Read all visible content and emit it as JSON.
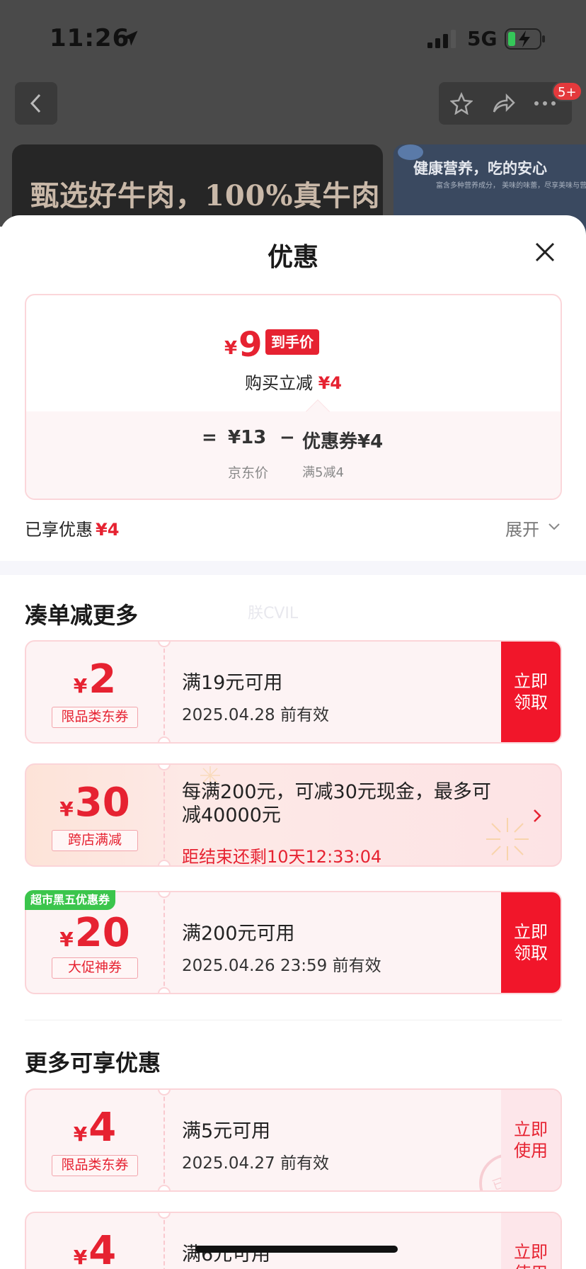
{
  "status_bar": {
    "time": "11:26",
    "network": "5G",
    "icons": [
      "location-icon",
      "signal-icon",
      "battery-charging-icon"
    ]
  },
  "background": {
    "cart_badge": "5+",
    "banner_main": "甄选好牛肉，100%真牛肉",
    "banner_side": "健康营养，吃的安心",
    "banner_side_sub": "富含多种营养成分，\n美味的味蕾，尽享美味与营养的双重盛宴。"
  },
  "sheet": {
    "title": "优惠",
    "price_card": {
      "currency": "¥",
      "final_price": "9",
      "final_tag": "到手价",
      "instant_label": "购买立减",
      "instant_amount": "¥4",
      "eq": "=",
      "jd_price": "¥13",
      "minus": "−",
      "coupon_part": "优惠券¥4",
      "jd_label": "京东价",
      "coupon_rule": "满5减4"
    },
    "enjoyed_label": "已享优惠",
    "enjoyed_amount": "¥4",
    "expand_label": "展开",
    "watermark": "朕CVIL",
    "section1_title": "凑单减更多",
    "section2_title": "更多可享优惠"
  },
  "coupons": [
    {
      "currency": "¥",
      "amount": "2",
      "type": "限品类东券",
      "condition": "满19元可用",
      "validity": "2025.04.28 前有效",
      "action": "立即领取"
    },
    {
      "currency": "¥",
      "amount": "30",
      "type": "跨店满减",
      "description": "每满200元，可减30元现金，最多可减40000元",
      "countdown": "距结束还剩10天12:33:04"
    },
    {
      "currency": "¥",
      "amount": "20",
      "type": "大促神券",
      "tag": "超市黑五优惠券",
      "condition": "满200元可用",
      "validity": "2025.04.26 23:59 前有效",
      "action": "立即领取"
    },
    {
      "currency": "¥",
      "amount": "4",
      "type": "限品类东券",
      "condition": "满5元可用",
      "validity": "2025.04.27 前有效",
      "action": "立即使用",
      "stamp": "已领"
    },
    {
      "currency": "¥",
      "amount": "4",
      "condition": "满6元可用",
      "action": "立即使用"
    }
  ],
  "colors": {
    "accent": "#e62231",
    "button_red": "#f1162a",
    "promo_green": "#3bc54c"
  }
}
